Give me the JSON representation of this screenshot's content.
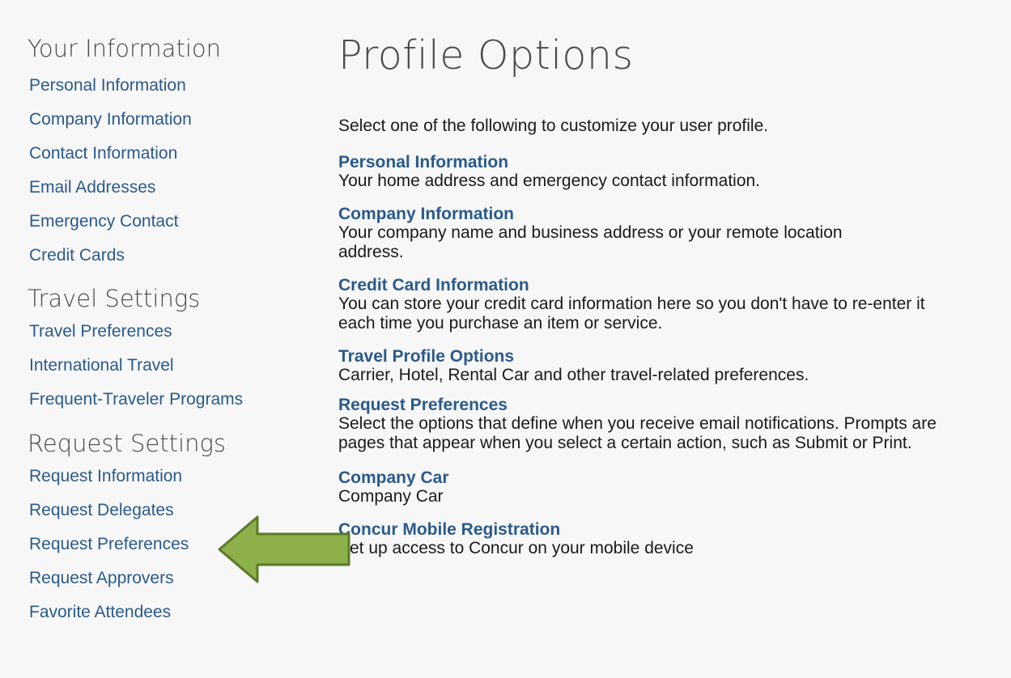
{
  "sidebar": {
    "sections": [
      {
        "heading": "Your Information",
        "items": [
          "Personal Information",
          "Company Information",
          "Contact Information",
          "Email Addresses",
          "Emergency Contact",
          "Credit Cards"
        ]
      },
      {
        "heading": "Travel Settings",
        "items": [
          "Travel Preferences",
          "International Travel",
          "Frequent-Traveler Programs"
        ]
      },
      {
        "heading": "Request Settings",
        "items": [
          "Request Information",
          "Request Delegates",
          "Request Preferences",
          "Request Approvers",
          "Favorite Attendees"
        ]
      }
    ]
  },
  "main": {
    "title": "Profile Options",
    "intro": "Select one of the following to customize your user profile.",
    "options": [
      {
        "title": "Personal Information",
        "desc": "Your home address and emergency contact information."
      },
      {
        "title": "Company Information",
        "desc": "Your company name and business address or your remote location address."
      },
      {
        "title": "Credit Card Information",
        "desc": "You can store your credit card information here so you don't have to re-enter it each time you purchase an item or service."
      },
      {
        "title": "Travel Profile Options",
        "desc": "Carrier, Hotel, Rental Car and other travel-related preferences."
      },
      {
        "title": "Request Preferences",
        "desc": "Select the options that define when you receive email notifications. Prompts are pages that appear when you select a certain action, such as Submit or Print."
      },
      {
        "title": "Company Car",
        "desc": "Company Car"
      },
      {
        "title": "Concur Mobile Registration",
        "desc": "Set up access to Concur on your mobile device"
      }
    ]
  },
  "annotation": {
    "arrow_icon": "left-arrow-icon",
    "arrow_fill": "#8db04a",
    "arrow_stroke": "#5a7a2a"
  }
}
